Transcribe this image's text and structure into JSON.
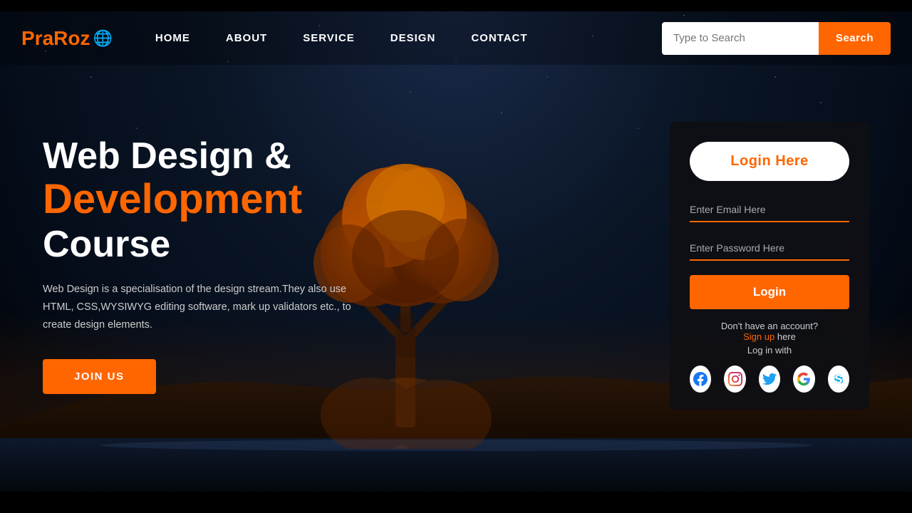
{
  "brand": {
    "name": "PraRoz",
    "globe_icon": "🌐"
  },
  "nav": {
    "links": [
      "HOME",
      "ABOUT",
      "SERVICE",
      "DESIGN",
      "CONTACT"
    ]
  },
  "search": {
    "placeholder": "Type to Search",
    "button_label": "Search"
  },
  "hero": {
    "title_line1": "Web Design &",
    "title_line2": "Development",
    "title_line3": "Course",
    "description": "Web Design is a specialisation of the design stream.They also use HTML, CSS,WYSIWYG editing software, mark up validators etc., to create design elements.",
    "cta_label": "JOIN US"
  },
  "login_card": {
    "title": "Login Here",
    "email_placeholder": "Enter Email Here",
    "password_placeholder": "Enter Password Here",
    "login_button": "Login",
    "no_account_text": "Don't have an account?",
    "signup_label": "Sign up",
    "signup_suffix": " here",
    "login_with_label": "Log in with",
    "social": [
      {
        "name": "facebook",
        "symbol": "f",
        "class": "fb"
      },
      {
        "name": "instagram",
        "symbol": "📷",
        "class": "ig"
      },
      {
        "name": "twitter",
        "symbol": "🐦",
        "class": "tw"
      },
      {
        "name": "google",
        "symbol": "G",
        "class": "goo"
      },
      {
        "name": "skype",
        "symbol": "S",
        "class": "sk"
      }
    ]
  },
  "colors": {
    "orange": "#ff6600",
    "dark_bg": "#0a1020",
    "card_bg": "rgba(15,15,20,0.92)"
  }
}
